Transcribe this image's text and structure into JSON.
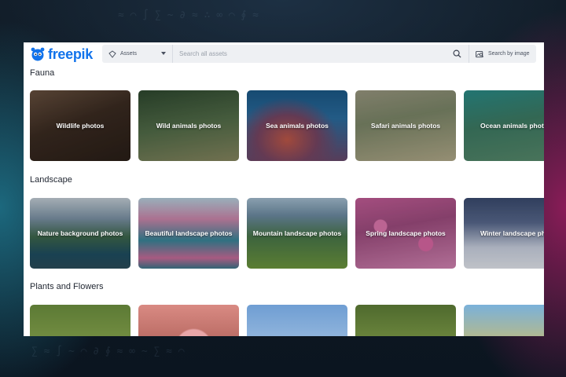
{
  "app": {
    "logo_text": "freepik",
    "brand_color": "#1273eb"
  },
  "search": {
    "asset_type": "Assets",
    "placeholder": "Search all assets",
    "value": "",
    "search_by_image_label": "Search by image"
  },
  "sections": [
    {
      "title": "Fauna",
      "cards": [
        {
          "label": "Wildlife photos"
        },
        {
          "label": "Wild animals photos"
        },
        {
          "label": "Sea animals photos"
        },
        {
          "label": "Safari animals photos"
        },
        {
          "label": "Ocean animals photos"
        }
      ]
    },
    {
      "title": "Landscape",
      "cards": [
        {
          "label": "Nature background photos"
        },
        {
          "label": "Beautiful landscape photos"
        },
        {
          "label": "Mountain landscape photos"
        },
        {
          "label": "Spring landscape photos"
        },
        {
          "label": "Winter landscape photos"
        }
      ]
    },
    {
      "title": "Plants and Flowers",
      "cards": [
        {
          "label": ""
        },
        {
          "label": ""
        },
        {
          "label": ""
        },
        {
          "label": ""
        },
        {
          "label": ""
        }
      ]
    }
  ]
}
